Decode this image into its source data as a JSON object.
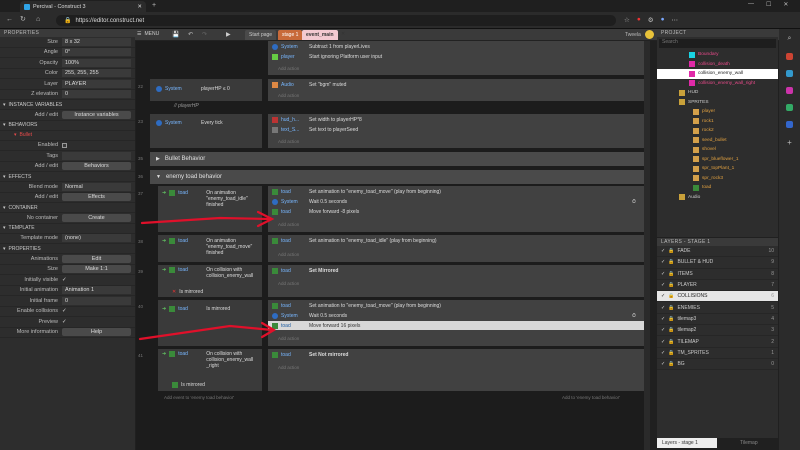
{
  "browser": {
    "tab_title": "Percival - Construct 3",
    "url": "https://editor.construct.net"
  },
  "editor": {
    "menu": "MENU",
    "tabs": [
      "Start page",
      "stage 1",
      "event_main"
    ],
    "user": "Tweela"
  },
  "properties": {
    "header": "PROPERTIES",
    "top_rows": [
      {
        "k": "Size",
        "v": "8 x 32"
      },
      {
        "k": "Angle",
        "v": "0°"
      },
      {
        "k": "Opacity",
        "v": "100%"
      },
      {
        "k": "Color",
        "v": "255, 255, 255"
      },
      {
        "k": "Layer",
        "v": "PLAYER"
      },
      {
        "k": "Z elevation",
        "v": "0"
      }
    ],
    "inst_vars": "INSTANCE VARIABLES",
    "add_edit": "Add / edit",
    "inst_btn": "Instance variables",
    "behaviors": "BEHAVIORS",
    "bullet": "Bullet",
    "enabled": "Enabled",
    "tags": "Tags",
    "behaviors_btn": "Behaviors",
    "effects": "EFFECTS",
    "blend": "Blend mode",
    "blend_v": "Normal",
    "effects_btn": "Effects",
    "container": "CONTAINER",
    "no_container": "No container",
    "create": "Create",
    "template": "TEMPLATE",
    "template_mode": "Template mode",
    "template_v": "(none)",
    "props2": "PROPERTIES",
    "animations": "Animations",
    "edit": "Edit",
    "size": "Size",
    "make11": "Make 1:1",
    "init_vis": "Initially visible",
    "init_anim": "Initial animation",
    "init_anim_v": "Animation 1",
    "init_frame": "Initial frame",
    "init_frame_v": "0",
    "enable_coll": "Enable collisions",
    "preview": "Preview",
    "more": "More information",
    "help": "Help"
  },
  "sheet": {
    "top_actions": [
      {
        "o": "System",
        "t": "Subtract 1 from playerLives"
      },
      {
        "o": "player",
        "t": "Start ignoring  Platform user input"
      }
    ],
    "add_action": "Add action",
    "ev22": {
      "num": "22",
      "c_obj": "System",
      "c_text": "playerHP ≤ 0",
      "a_obj": "Audio",
      "a_text": "Set \"bgm\" muted"
    },
    "comment": "// playerHP",
    "ev23": {
      "num": "23",
      "c_obj": "System",
      "c_text": "Every tick",
      "a": [
        {
          "o": "hud_h...",
          "t": "Set width to playerHP*8"
        },
        {
          "o": "text_S...",
          "t": "Set text to playerSeed"
        }
      ]
    },
    "grp1": "Bullet Behavior",
    "grp1_num": "35",
    "grp2": "enemy toad behavior",
    "grp2_num": "36",
    "e37": {
      "num": "37",
      "c_obj": "toad",
      "c_text": "On animation \"enemy_toad_idle\" finished",
      "a": [
        {
          "o": "toad",
          "t": "Set animation to \"enemy_toad_move\" (play from beginning)"
        },
        {
          "o": "System",
          "t": "Wait 0.5 seconds"
        },
        {
          "o": "toad",
          "t": "Move forward -8 pixels"
        }
      ]
    },
    "e38": {
      "num": "38",
      "c_obj": "toad",
      "c_text": "On animation \"enemy_toad_move\" finished",
      "a": [
        {
          "o": "toad",
          "t": "Set animation to \"enemy_toad_idle\" (play from beginning)"
        }
      ]
    },
    "e39": {
      "num": "39",
      "c_obj": "toad",
      "c_text": "On collision with collision_enemy_wall",
      "c2": "Is mirrored",
      "a": [
        {
          "o": "toad",
          "t": "Set Mirrored"
        }
      ]
    },
    "e40": {
      "num": "40",
      "c_obj": "toad",
      "c_text": "Is mirrored",
      "a": [
        {
          "o": "toad",
          "t": "Set animation to \"enemy_toad_move\" (play from beginning)"
        },
        {
          "o": "System",
          "t": "Wait 0.5 seconds"
        },
        {
          "o": "toad",
          "t": "Move forward 16 pixels"
        }
      ]
    },
    "e41": {
      "num": "41",
      "c_obj": "toad",
      "c_text": "On collision with collision_enemy_wall _right",
      "c2": "Is mirrored",
      "a": [
        {
          "o": "toad",
          "t": "Set Not mirrored"
        }
      ]
    },
    "add_event": "Add event to 'enemy toad behavior'",
    "add_to": "Add to 'enemy toad behavior'"
  },
  "project": {
    "header": "PROJECT",
    "search": "Search",
    "items": [
      "Boundary",
      "collision_death",
      "collision_enemy_wall",
      "collision_enemy_wall_right",
      "HUD",
      "SPRITES",
      "player",
      "rock1",
      "rock2",
      "seed_bullet",
      "shovel",
      "spr_blueflower_1",
      "spr_topPlant_1",
      "spr_rock3",
      "toad",
      "Audio"
    ]
  },
  "layers": {
    "header": "LAYERS - STAGE 1",
    "rows": [
      {
        "n": "FADE",
        "c": "10"
      },
      {
        "n": "BULLET & HUD",
        "c": "9"
      },
      {
        "n": "ITEMS",
        "c": "8"
      },
      {
        "n": "PLAYER",
        "c": "7"
      },
      {
        "n": "COLLISIONS",
        "c": "6"
      },
      {
        "n": "ENEMIES",
        "c": "5"
      },
      {
        "n": "tilemap3",
        "c": "4"
      },
      {
        "n": "tilemap2",
        "c": "3"
      },
      {
        "n": "TILEMAP",
        "c": "2"
      },
      {
        "n": "TM_SPRITES",
        "c": "1"
      },
      {
        "n": "BG",
        "c": "0"
      }
    ],
    "tab1": "Layers - stage 1",
    "tab2": "Tilemap"
  },
  "colors": {
    "arrow": "#e0102a",
    "accent": "#e84a8a"
  }
}
